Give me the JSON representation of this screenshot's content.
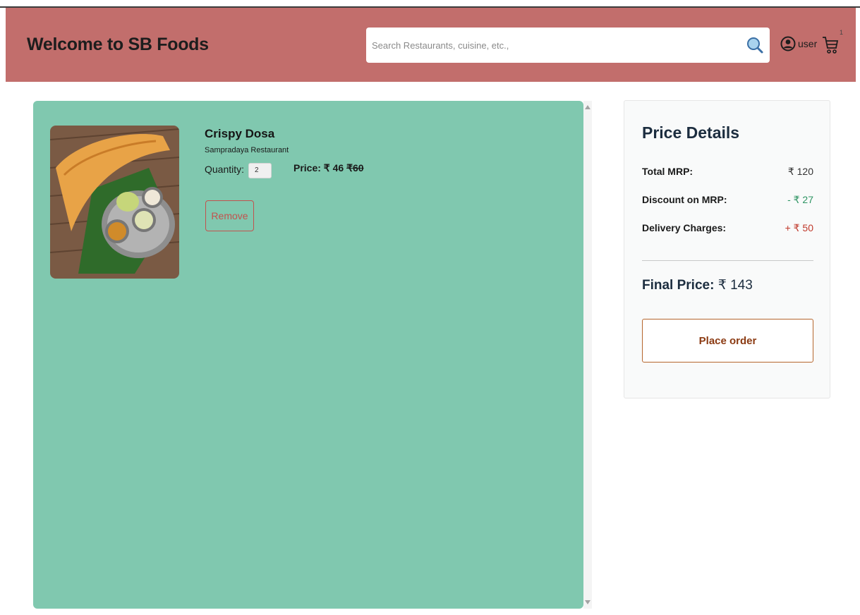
{
  "header": {
    "brand": "Welcome to SB Foods",
    "search_placeholder": "Search Restaurants, cuisine, etc.,",
    "user_label": "user",
    "cart_count": "1"
  },
  "cart": {
    "items": [
      {
        "name": "Crispy Dosa",
        "restaurant": "Sampradaya Restaurant",
        "quantity_label": "Quantity:",
        "quantity": "2",
        "price_label": "Price: ₹ 46",
        "original_price": "₹60",
        "remove_label": "Remove"
      }
    ]
  },
  "price_details": {
    "title": "Price Details",
    "rows": [
      {
        "label": "Total MRP:",
        "value": "₹ 120"
      },
      {
        "label": "Discount on MRP:",
        "value": "- ₹ 27"
      },
      {
        "label": "Delivery Charges:",
        "value": "+ ₹ 50"
      }
    ],
    "final_label": "Final Price:",
    "final_value": "₹ 143",
    "place_order_label": "Place order"
  },
  "colors": {
    "header_bg": "#c26e6c",
    "cart_panel_bg": "#80c8af",
    "discount": "#2e9463",
    "delivery": "#c0392b",
    "remove_accent": "#c2524e"
  }
}
